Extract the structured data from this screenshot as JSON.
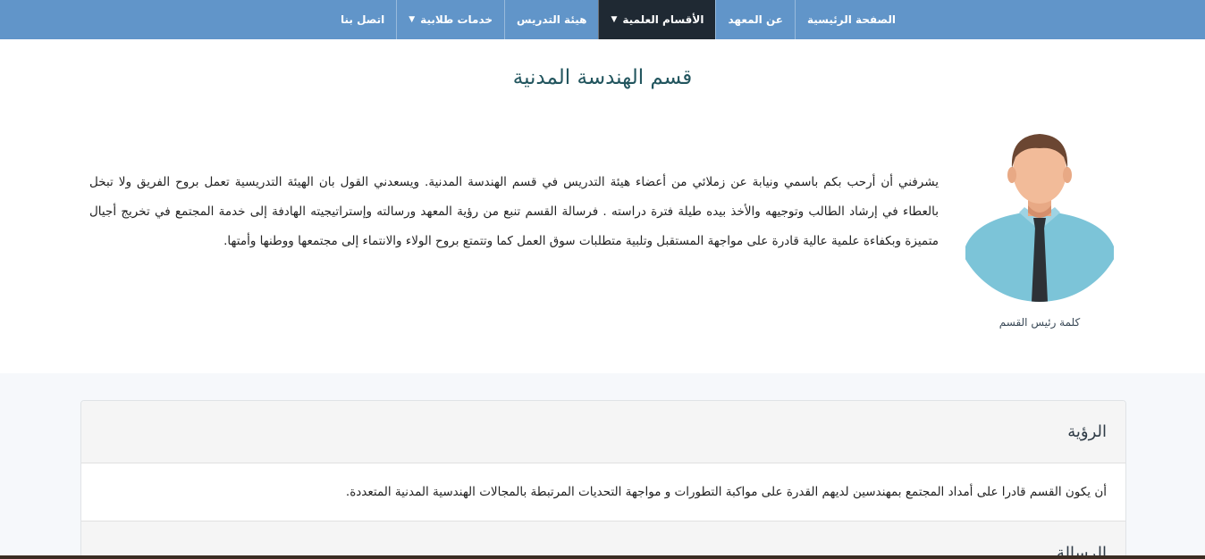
{
  "nav": {
    "items": [
      {
        "label": "الصفحة الرئيسية",
        "dropdown": false,
        "active": false
      },
      {
        "label": "عن المعهد",
        "dropdown": false,
        "active": false
      },
      {
        "label": "الأقسام العلمية",
        "dropdown": true,
        "active": true
      },
      {
        "label": "هيئة التدريس",
        "dropdown": false,
        "active": false
      },
      {
        "label": "خدمات طلابية",
        "dropdown": true,
        "active": false
      },
      {
        "label": "اتصل بنا",
        "dropdown": false,
        "active": false
      }
    ]
  },
  "page": {
    "title": "قسم الهندسة المدنية"
  },
  "head_message": {
    "caption": "كلمة رئيس القسم",
    "text": "يشرفني أن أرحب بكم باسمي ونيابة عن زملائي من أعضاء هيئة التدريس في قسم الهندسة المدنية. ويسعدني القول بان الهيئة التدريسية تعمل بروح الفريق ولا تبخل بالعطاء في إرشاد الطالب وتوجيهه والأخذ بيده طيلة فترة دراسته . فرسالة القسم تنبع من رؤية المعهد ورسالته وإستراتيجيته الهادفة إلى خدمة المجتمع في تخريج أجيال متميزة وبكفاءة علمية عالية قادرة على مواجهة المستقبل وتلبية متطلبات سوق العمل كما وتتمتع بروح الولاء والانتماء إلى مجتمعها ووطنها وأمتها."
  },
  "sections": {
    "vision_title": "الرؤية",
    "vision_text": "أن يكون القسم قادرا على أمداد المجتمع بمهندسين لديهم القدرة على مواكبة التطورات و مواجهة التحديات المرتبطة بالمجالات الهندسية المدنية المتعددة.",
    "mission_title": "الرسالة"
  },
  "colors": {
    "nav_bg": "#6195c9",
    "nav_active_bg": "#1f2933",
    "title": "#22555e"
  }
}
